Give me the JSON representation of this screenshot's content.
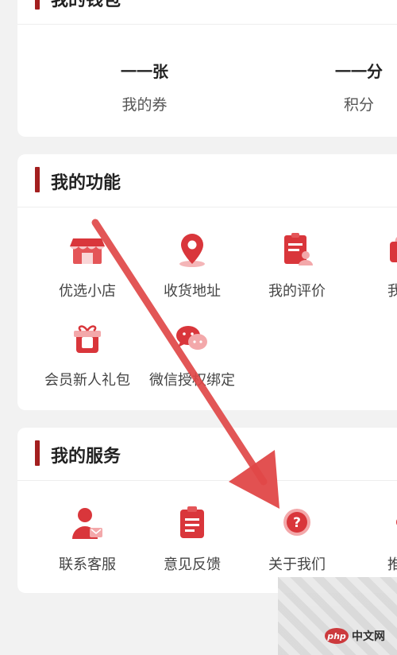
{
  "wallet": {
    "title": "我的钱包",
    "items": [
      {
        "value": "一一张",
        "label": "我的券"
      },
      {
        "value": "一一分",
        "label": "积分"
      }
    ]
  },
  "functions": {
    "title": "我的功能",
    "items": [
      {
        "label": "优选小店",
        "icon": "shop-icon"
      },
      {
        "label": "收货地址",
        "icon": "location-icon"
      },
      {
        "label": "我的评价",
        "icon": "review-icon"
      },
      {
        "label": "我的",
        "icon": "bag-icon"
      },
      {
        "label": "会员新人礼包",
        "icon": "gift-icon"
      },
      {
        "label": "微信授权绑定",
        "icon": "chat-icon"
      }
    ]
  },
  "services": {
    "title": "我的服务",
    "items": [
      {
        "label": "联系客服",
        "icon": "customer-service-icon"
      },
      {
        "label": "意见反馈",
        "icon": "feedback-icon"
      },
      {
        "label": "关于我们",
        "icon": "question-icon"
      },
      {
        "label": "推荐",
        "icon": "recommend-icon"
      }
    ]
  },
  "watermark": {
    "logo": "php",
    "site": "中文网"
  },
  "colors": {
    "accent": "#a31f1f",
    "icon_red": "#d9363b",
    "arrow": "#e04848"
  }
}
